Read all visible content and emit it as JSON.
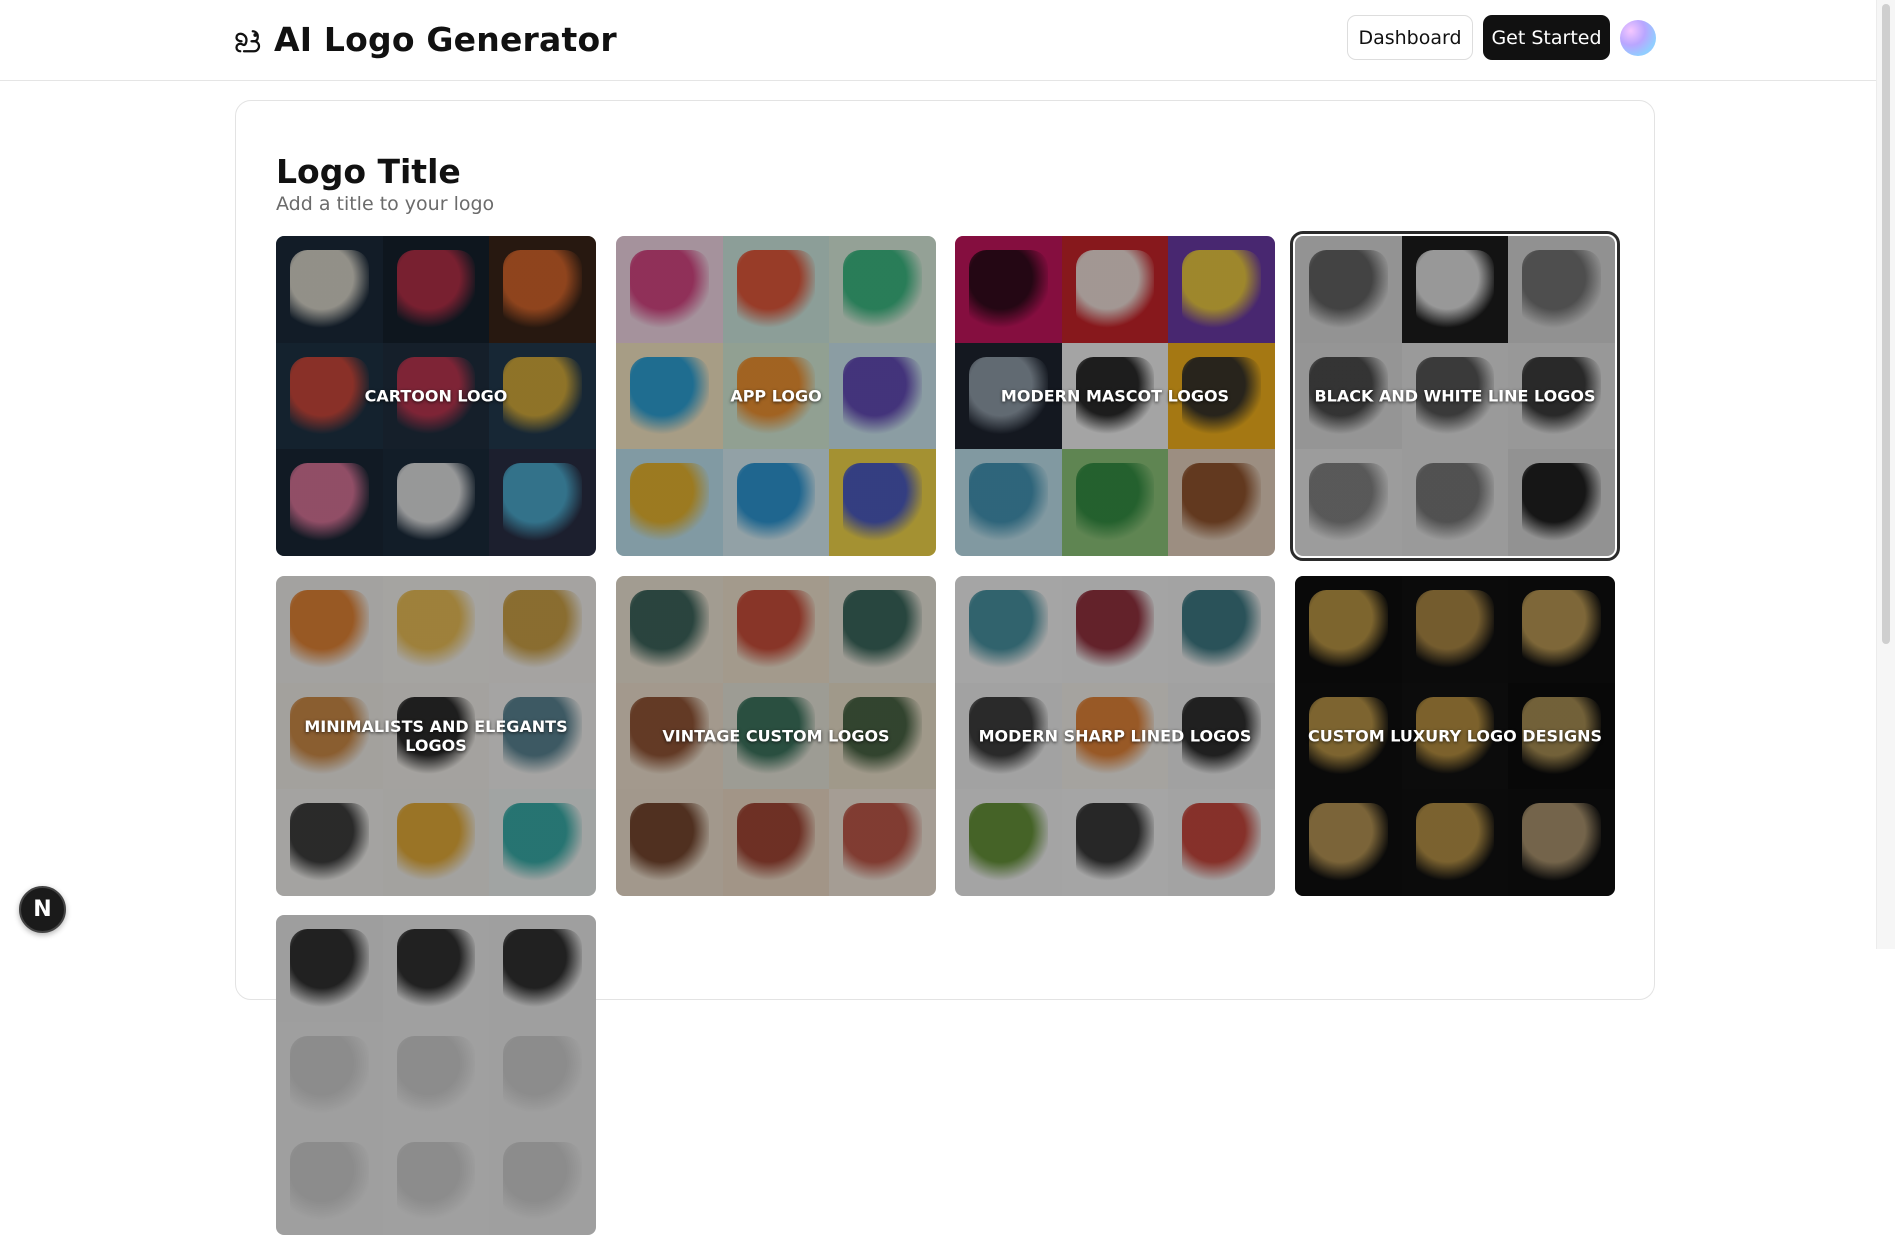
{
  "header": {
    "app_title": "AI Logo Generator",
    "logo_icon": "squirrel-icon",
    "dashboard_label": "Dashboard",
    "get_started_label": "Get Started"
  },
  "section": {
    "title": "Logo Title",
    "subtitle": "Add a title to your logo"
  },
  "styles": [
    {
      "label": "CARTOON LOGO",
      "selected": false,
      "palette": [
        "#1b2a3a",
        "#16212d",
        "#3a2418",
        "#1e3345",
        "#1f2f3f",
        "#223a4f",
        "#1a2735",
        "#1b2b3b",
        "#2a2f45"
      ],
      "accents": [
        "#e9e4d6",
        "#c0314a",
        "#e06b2e",
        "#d94a3b",
        "#c73752",
        "#e2b43a",
        "#e67aa0",
        "#f0f0f0",
        "#4fb3d8"
      ]
    },
    {
      "label": "APP LOGO",
      "selected": false,
      "palette": [
        "#f3d7e6",
        "#cfe9e0",
        "#dbeedd",
        "#f6e7c5",
        "#d6ecd8",
        "#cde7f1",
        "#bfe4f0",
        "#d8eef5",
        "#f2d64b"
      ],
      "accents": [
        "#d23a7a",
        "#e24c2e",
        "#2fb37a",
        "#1d9bd6",
        "#f08a24",
        "#5b3fb0",
        "#e9b020",
        "#1f8fd0",
        "#3f52c8"
      ]
    },
    {
      "label": "MODERN MASCOT LOGOS",
      "selected": false,
      "palette": [
        "#c4155e",
        "#c8242a",
        "#6b3aa5",
        "#1e2430",
        "#f2f2f2",
        "#f3b21c",
        "#bfe2ee",
        "#8cc47a",
        "#e6d2bf"
      ],
      "accents": [
        "#2a0a18",
        "#f3efe8",
        "#f4d43a",
        "#9aa7b3",
        "#1a1a1a",
        "#2b2b2b",
        "#3b8fb0",
        "#2e8a3f",
        "#8a4a22"
      ]
    },
    {
      "label": "BLACK AND WHITE LINE LOGOS",
      "selected": true,
      "palette": [
        "#d9d9d9",
        "#1d1d1d",
        "#d6d6d6",
        "#dcdcdc",
        "#e3e3e3",
        "#e0e0e0",
        "#e6e6e6",
        "#e3e3e3",
        "#d8d8d8"
      ],
      "accents": [
        "#5a5a5a",
        "#f1f1f1",
        "#6a6a6a",
        "#404040",
        "#4a4a4a",
        "#2f2f2f",
        "#7a7a7a",
        "#6f6f6f",
        "#111111"
      ]
    },
    {
      "label": "MINIMALISTS AND ELEGANTS LOGOS",
      "selected": false,
      "palette": [
        "#f1efec",
        "#f4f2ee",
        "#f3f1ee",
        "#f0ede8",
        "#f2efea",
        "#f3f2f0",
        "#f2f1ee",
        "#f1efea",
        "#eef2f1"
      ],
      "accents": [
        "#e07a26",
        "#e8b94a",
        "#c89a3a",
        "#c9823a",
        "#1c1c1c",
        "#4d7a8a",
        "#2e2e2e",
        "#e2a52a",
        "#2aa6a1"
      ]
    },
    {
      "label": "VINTAGE CUSTOM LOGOS",
      "selected": false,
      "palette": [
        "#efe6d6",
        "#f0e3cf",
        "#ebe7dc",
        "#f0e2d0",
        "#e8e6da",
        "#ece2cc",
        "#efe1cf",
        "#efdcc8",
        "#f3e7db"
      ],
      "accents": [
        "#2f5a52",
        "#c6422e",
        "#2d5d52",
        "#8a4a2a",
        "#2f6b54",
        "#3d5a3a",
        "#6b3a22",
        "#9b3b2a",
        "#b94d3d"
      ]
    },
    {
      "label": "MODERN SHARP LINED LOGOS",
      "selected": false,
      "palette": [
        "#f3f3f3",
        "#f2f2f2",
        "#f1f1f1",
        "#efefef",
        "#f3f0ea",
        "#eeeeee",
        "#f2f2f2",
        "#f3f3f3",
        "#f1f1f1"
      ],
      "accents": [
        "#3a8a9a",
        "#8a2230",
        "#2f6f7a",
        "#2f2f2f",
        "#e07a2a",
        "#1f1f1f",
        "#5a8a2a",
        "#2a2a2a",
        "#c23a2e"
      ]
    },
    {
      "label": "CUSTOM LUXURY LOGO DESIGNS",
      "selected": false,
      "palette": [
        "#0e0e0e",
        "#111111",
        "#0f0f0f",
        "#101010",
        "#121212",
        "#0d0d0d",
        "#0f0f0f",
        "#111111",
        "#101010"
      ],
      "accents": [
        "#c8a14a",
        "#b8924a",
        "#c9a55a",
        "#c7a04c",
        "#c59b45",
        "#b69a5a",
        "#c4a05a",
        "#c39c4b",
        "#b9a077"
      ]
    },
    {
      "label": "",
      "selected": false,
      "palette": [
        "#e9e9e9",
        "#ececec",
        "#ebebeb",
        "#eaeaea",
        "#ececec",
        "#ebebeb",
        "#eaeaea",
        "#ececec",
        "#ebebeb"
      ],
      "accents": [
        "#222222",
        "#222222",
        "#222222",
        "#cccccc",
        "#cccccc",
        "#cccccc",
        "#cccccc",
        "#cccccc",
        "#cccccc"
      ]
    }
  ],
  "dev_badge": "N"
}
